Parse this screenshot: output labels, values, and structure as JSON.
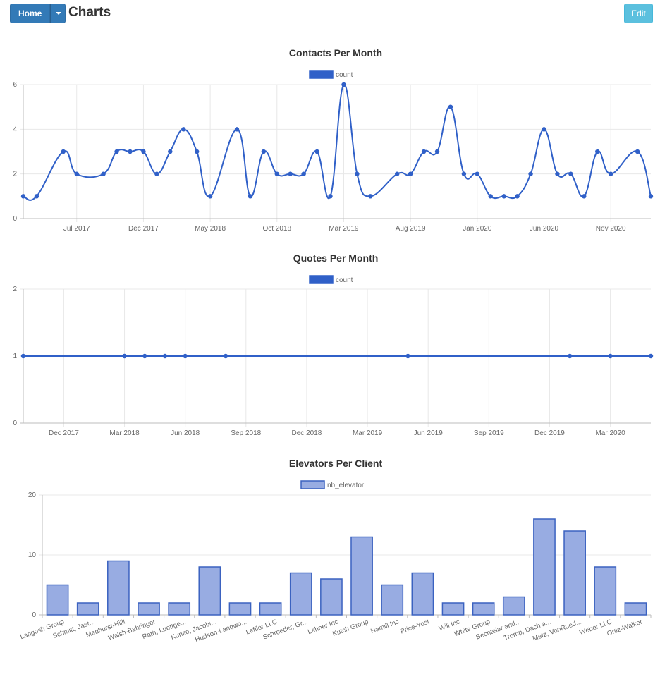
{
  "header": {
    "home_label": "Home",
    "title": "Charts",
    "edit_label": "Edit"
  },
  "colors": {
    "series_line": "#3060C8",
    "bar_fill": "#98ACE2",
    "bar_border": "#3B62C0",
    "grid": "#e8e8e8",
    "axis": "#bdbdbd",
    "tick_text": "#666666"
  },
  "chart_data": [
    {
      "type": "line",
      "title": "Contacts Per Month",
      "legend": "count",
      "legend_position": "top",
      "grid": true,
      "ylim": [
        0,
        6
      ],
      "yticks": [
        0,
        2,
        4,
        6
      ],
      "xlim": [
        "2017-03",
        "2021-02"
      ],
      "xticks": [
        {
          "x": "2017-07",
          "label": "Jul 2017"
        },
        {
          "x": "2017-12",
          "label": "Dec 2017"
        },
        {
          "x": "2018-05",
          "label": "May 2018"
        },
        {
          "x": "2018-10",
          "label": "Oct 2018"
        },
        {
          "x": "2019-03",
          "label": "Mar 2019"
        },
        {
          "x": "2019-08",
          "label": "Aug 2019"
        },
        {
          "x": "2020-01",
          "label": "Jan 2020"
        },
        {
          "x": "2020-06",
          "label": "Jun 2020"
        },
        {
          "x": "2020-11",
          "label": "Nov 2020"
        }
      ],
      "series": [
        {
          "name": "count",
          "points": [
            [
              "2017-03",
              1
            ],
            [
              "2017-04",
              1
            ],
            [
              "2017-06",
              3
            ],
            [
              "2017-07",
              2
            ],
            [
              "2017-09",
              2
            ],
            [
              "2017-10",
              3
            ],
            [
              "2017-11",
              3
            ],
            [
              "2017-12",
              3
            ],
            [
              "2018-01",
              2
            ],
            [
              "2018-02",
              3
            ],
            [
              "2018-03",
              4
            ],
            [
              "2018-04",
              3
            ],
            [
              "2018-05",
              1
            ],
            [
              "2018-07",
              4
            ],
            [
              "2018-08",
              1
            ],
            [
              "2018-09",
              3
            ],
            [
              "2018-10",
              2
            ],
            [
              "2018-11",
              2
            ],
            [
              "2018-12",
              2
            ],
            [
              "2019-01",
              3
            ],
            [
              "2019-02",
              1
            ],
            [
              "2019-03",
              6
            ],
            [
              "2019-04",
              2
            ],
            [
              "2019-05",
              1
            ],
            [
              "2019-07",
              2
            ],
            [
              "2019-08",
              2
            ],
            [
              "2019-09",
              3
            ],
            [
              "2019-10",
              3
            ],
            [
              "2019-11",
              5
            ],
            [
              "2019-12",
              2
            ],
            [
              "2020-01",
              2
            ],
            [
              "2020-02",
              1
            ],
            [
              "2020-03",
              1
            ],
            [
              "2020-04",
              1
            ],
            [
              "2020-05",
              2
            ],
            [
              "2020-06",
              4
            ],
            [
              "2020-07",
              2
            ],
            [
              "2020-08",
              2
            ],
            [
              "2020-09",
              1
            ],
            [
              "2020-10",
              3
            ],
            [
              "2020-11",
              2
            ],
            [
              "2021-01",
              3
            ],
            [
              "2021-02",
              1
            ]
          ]
        }
      ]
    },
    {
      "type": "line",
      "title": "Quotes Per Month",
      "legend": "count",
      "legend_position": "top",
      "grid": true,
      "ylim": [
        0,
        2
      ],
      "yticks": [
        0,
        1,
        2
      ],
      "xlim": [
        "2017-10",
        "2020-05"
      ],
      "xticks": [
        {
          "x": "2017-12",
          "label": "Dec 2017"
        },
        {
          "x": "2018-03",
          "label": "Mar 2018"
        },
        {
          "x": "2018-06",
          "label": "Jun 2018"
        },
        {
          "x": "2018-09",
          "label": "Sep 2018"
        },
        {
          "x": "2018-12",
          "label": "Dec 2018"
        },
        {
          "x": "2019-03",
          "label": "Mar 2019"
        },
        {
          "x": "2019-06",
          "label": "Jun 2019"
        },
        {
          "x": "2019-09",
          "label": "Sep 2019"
        },
        {
          "x": "2019-12",
          "label": "Dec 2019"
        },
        {
          "x": "2020-03",
          "label": "Mar 2020"
        }
      ],
      "series": [
        {
          "name": "count",
          "points": [
            [
              "2017-10",
              1
            ],
            [
              "2018-03",
              1
            ],
            [
              "2018-04",
              1
            ],
            [
              "2018-05",
              1
            ],
            [
              "2018-06",
              1
            ],
            [
              "2018-08",
              1
            ],
            [
              "2019-05",
              1
            ],
            [
              "2020-01",
              1
            ],
            [
              "2020-03",
              1
            ],
            [
              "2020-05",
              1
            ]
          ]
        }
      ]
    },
    {
      "type": "bar",
      "title": "Elevators Per Client",
      "legend": "nb_elevator",
      "legend_position": "top",
      "grid": true,
      "ylim": [
        0,
        20
      ],
      "yticks": [
        0,
        10,
        20
      ],
      "categories": [
        "Langosh Group",
        "Schmitt, Jast...",
        "Medhurst-Hilll",
        "Walsh-Bahringer",
        "Rath, Luettge...",
        "Kunze, Jacobi...",
        "Hudson-Langwo...",
        "Leffler LLC",
        "Schroeder, Gr...",
        "Lehner Inc",
        "Kutch Group",
        "Hamill Inc",
        "Price-Yost",
        "Will Inc",
        "White Group",
        "Bechtelar and...",
        "Tromp, Dach a...",
        "Metz, VonRued...",
        "Weber LLC",
        "Ortiz-Walker"
      ],
      "series": [
        {
          "name": "nb_elevator",
          "values": [
            5,
            2,
            9,
            2,
            2,
            8,
            2,
            2,
            7,
            6,
            13,
            5,
            7,
            2,
            2,
            3,
            16,
            14,
            8,
            2
          ]
        }
      ]
    }
  ]
}
